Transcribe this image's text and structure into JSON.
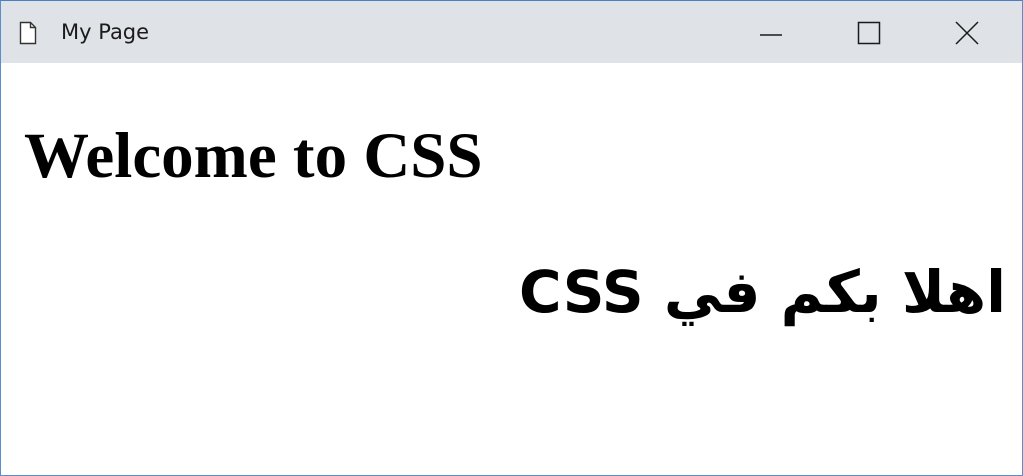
{
  "window": {
    "title": "My Page",
    "icons": {
      "document": "document-icon",
      "minimize": "minimize-icon",
      "maximize": "maximize-icon",
      "close": "close-icon"
    },
    "colors": {
      "titlebar": "#dfe2e6",
      "border": "#5b8dc9",
      "content": "#ffffff",
      "text": "#000000"
    }
  },
  "content": {
    "heading_en": "Welcome to CSS",
    "heading_ar": "اهلا بكم في CSS"
  }
}
